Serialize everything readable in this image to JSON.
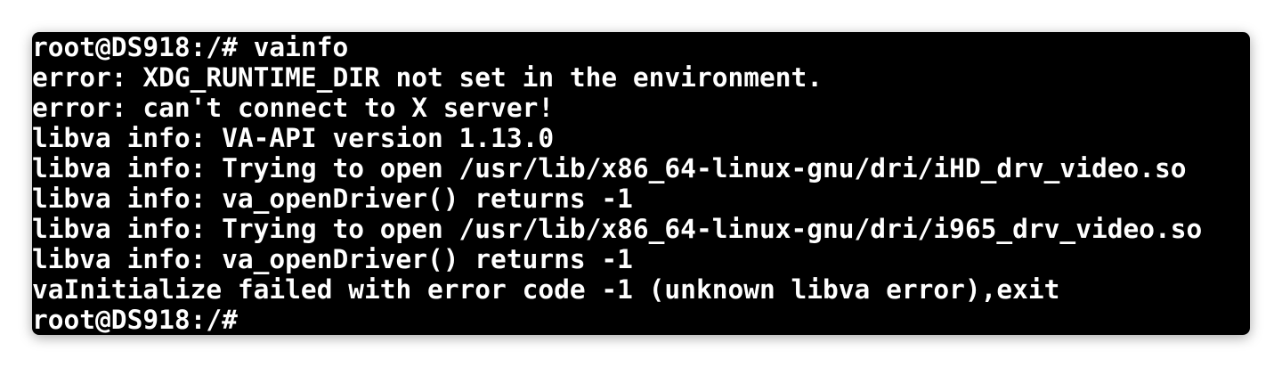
{
  "terminal": {
    "background_color": "#000000",
    "text_color": "#ffffff",
    "lines": [
      "root@DS918:/# vainfo",
      "error: XDG_RUNTIME_DIR not set in the environment.",
      "error: can't connect to X server!",
      "libva info: VA-API version 1.13.0",
      "libva info: Trying to open /usr/lib/x86_64-linux-gnu/dri/iHD_drv_video.so",
      "libva info: va_openDriver() returns -1",
      "libva info: Trying to open /usr/lib/x86_64-linux-gnu/dri/i965_drv_video.so",
      "libva info: va_openDriver() returns -1",
      "vaInitialize failed with error code -1 (unknown libva error),exit"
    ],
    "prompt": "root@DS918:/#"
  }
}
